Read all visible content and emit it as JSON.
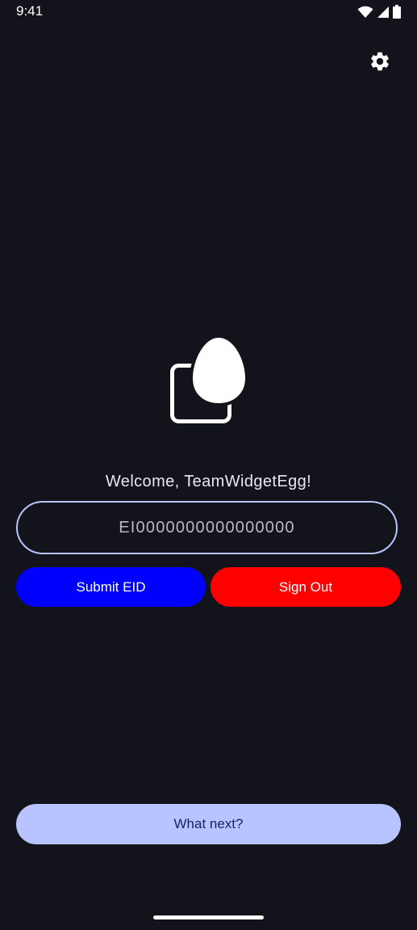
{
  "status_bar": {
    "time": "9:41",
    "icons": [
      "wifi-icon",
      "cellular-signal-icon",
      "battery-icon"
    ]
  },
  "header": {
    "settings_icon": "gear-icon"
  },
  "logo": {
    "icon": "egg-widget-logo"
  },
  "main": {
    "welcome_text": "Welcome, TeamWidgetEgg!",
    "eid_input": {
      "value": "EI0000000000000000",
      "placeholder": ""
    },
    "submit_label": "Submit EID",
    "signout_label": "Sign Out",
    "next_label": "What next?"
  },
  "colors": {
    "background": "#13141b",
    "field_border": "#b8c4ff",
    "submit": "#0000ff",
    "signout": "#ff0000",
    "next_bg": "#b8c4ff",
    "next_text": "#1a2361"
  }
}
